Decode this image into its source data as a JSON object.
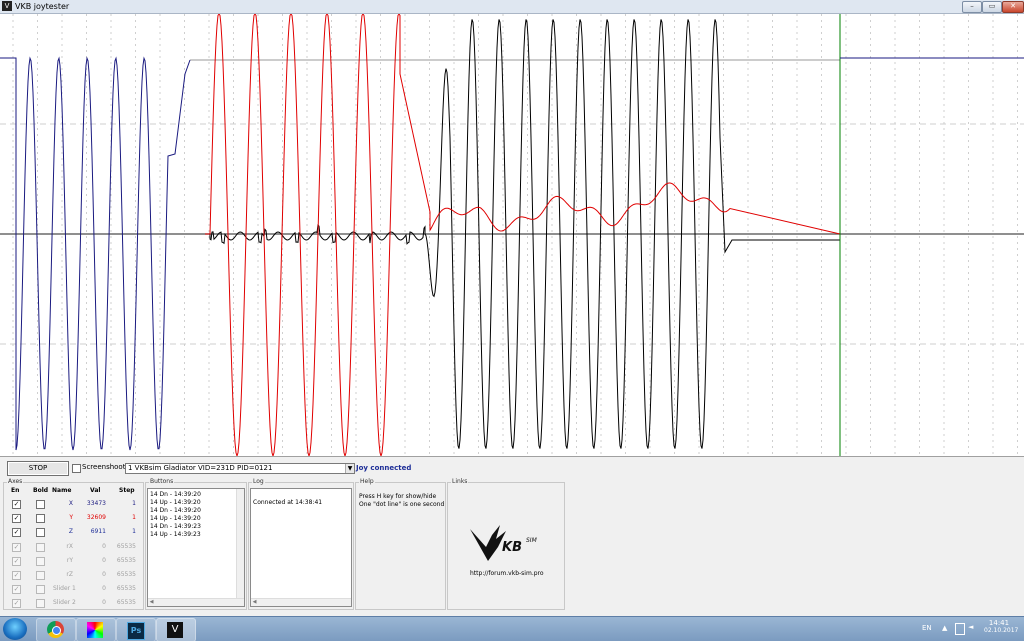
{
  "window": {
    "title": "VKB joytester",
    "app_icon": "vkb-logo-icon",
    "buttons": {
      "minimize": "minimize-icon",
      "maximize": "maximize-icon",
      "close": "close-icon"
    }
  },
  "plot": {
    "background": "#ffffff",
    "traces": [
      {
        "name": "X",
        "color": "#1a1a80"
      },
      {
        "name": "Y",
        "color": "#e00000"
      },
      {
        "name": "Z",
        "color": "#000000"
      }
    ],
    "cursor_color": "#008000"
  },
  "controls": {
    "stop_label": "STOP",
    "screenshot_label": "Screenshoot",
    "device_selected": "1 VKBsim Gladiator  VID=231D PID=0121",
    "status": "Joy connected",
    "status_color": "#1f2f98"
  },
  "axes": {
    "group_title": "Axes",
    "headers": {
      "en": "En",
      "bold": "Bold",
      "name": "Name",
      "val": "Val",
      "step": "Step"
    },
    "rows": [
      {
        "en": true,
        "bold": false,
        "name": "X",
        "val": "33473",
        "step": "1",
        "enabled": true,
        "color": "#1a1a80"
      },
      {
        "en": true,
        "bold": false,
        "name": "Y",
        "val": "32609",
        "step": "1",
        "enabled": true,
        "color": "#e00000"
      },
      {
        "en": true,
        "bold": false,
        "name": "Z",
        "val": "6911",
        "step": "1",
        "enabled": true,
        "color": "#1f2f98"
      },
      {
        "en": true,
        "bold": false,
        "name": "rX",
        "val": "0",
        "step": "65535",
        "enabled": false,
        "color": "#a0a0a0"
      },
      {
        "en": true,
        "bold": false,
        "name": "rY",
        "val": "0",
        "step": "65535",
        "enabled": false,
        "color": "#a0a0a0"
      },
      {
        "en": true,
        "bold": false,
        "name": "rZ",
        "val": "0",
        "step": "65535",
        "enabled": false,
        "color": "#a0a0a0"
      },
      {
        "en": true,
        "bold": false,
        "name": "Slider 1",
        "val": "0",
        "step": "65535",
        "enabled": false,
        "color": "#a0a0a0"
      },
      {
        "en": true,
        "bold": false,
        "name": "Slider 2",
        "val": "0",
        "step": "65535",
        "enabled": false,
        "color": "#a0a0a0"
      }
    ]
  },
  "buttons_panel": {
    "group_title": "Buttons",
    "entries": [
      "14 Dn - 14:39:20",
      "14 Up - 14:39:20",
      "14 Dn - 14:39:20",
      "14 Up - 14:39:20",
      "14 Dn - 14:39:23",
      "14 Up - 14:39:23"
    ]
  },
  "log_panel": {
    "group_title": "Log",
    "entries": [
      "Connected at 14:38:41"
    ]
  },
  "help_panel": {
    "group_title": "Help",
    "lines": [
      "Press H key for show/hide",
      "One \"dot line\" is one second"
    ]
  },
  "links_panel": {
    "group_title": "Links",
    "logo_icon": "vkbsim-logo-icon",
    "url": "http://forum.vkb-sim.pro"
  },
  "taskbar": {
    "start_icon": "windows-start-icon",
    "items": [
      "chrome-icon",
      "color-picker-icon",
      "photoshop-icon",
      "vkb-joytester-icon"
    ],
    "language": "EN",
    "time": "14:41",
    "date": "02.10.2017"
  }
}
